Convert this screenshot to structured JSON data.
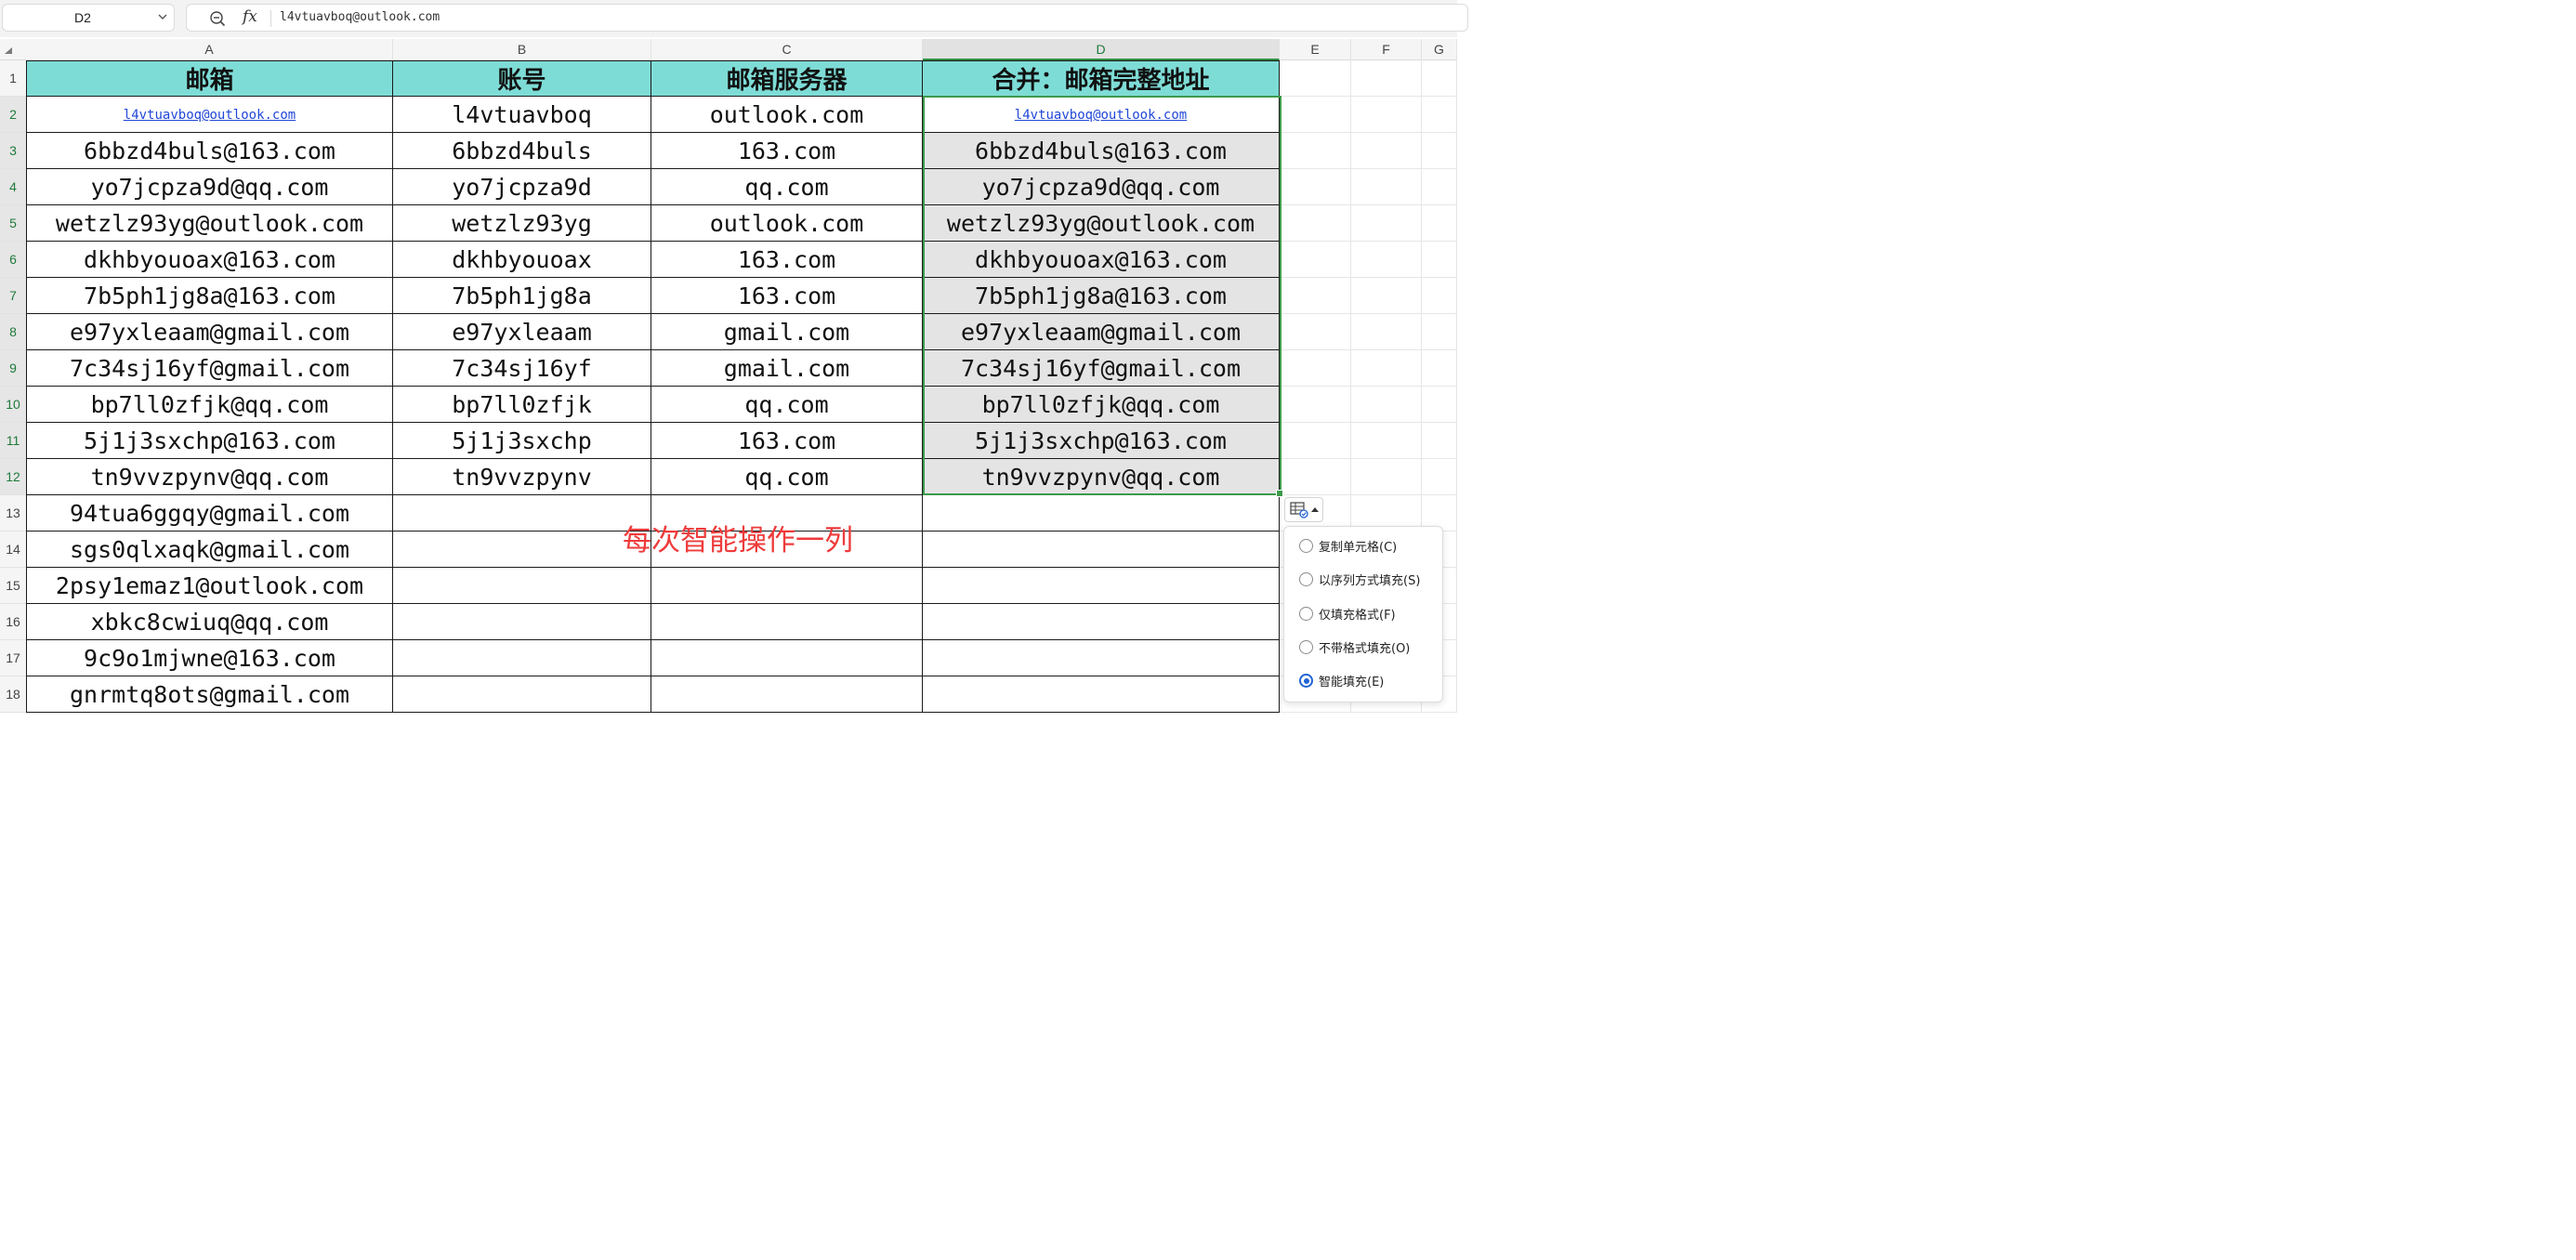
{
  "formula_bar": {
    "name_box": "D2",
    "fx_label": "fx",
    "formula": "l4vtuavboq@outlook.com"
  },
  "columns": [
    "A",
    "B",
    "C",
    "D",
    "E",
    "F",
    "G"
  ],
  "active_column": "D",
  "rows": [
    "1",
    "2",
    "3",
    "4",
    "5",
    "6",
    "7",
    "8",
    "9",
    "10",
    "11",
    "12",
    "13",
    "14",
    "15",
    "16",
    "17",
    "18"
  ],
  "sheet": {
    "headers": [
      "邮箱",
      "账号",
      "邮箱服务器",
      "合并：邮箱完整地址"
    ],
    "data": [
      [
        "l4vtuavboq@outlook.com",
        "l4vtuavboq",
        "outlook.com",
        "l4vtuavboq@outlook.com"
      ],
      [
        "6bbzd4buls@163.com",
        "6bbzd4buls",
        "163.com",
        "6bbzd4buls@163.com"
      ],
      [
        "yo7jcpza9d@qq.com",
        "yo7jcpza9d",
        "qq.com",
        "yo7jcpza9d@qq.com"
      ],
      [
        "wetzlz93yg@outlook.com",
        "wetzlz93yg",
        "outlook.com",
        "wetzlz93yg@outlook.com"
      ],
      [
        "dkhbyouoax@163.com",
        "dkhbyouoax",
        "163.com",
        "dkhbyouoax@163.com"
      ],
      [
        "7b5ph1jg8a@163.com",
        "7b5ph1jg8a",
        "163.com",
        "7b5ph1jg8a@163.com"
      ],
      [
        "e97yxleaam@gmail.com",
        "e97yxleaam",
        "gmail.com",
        "e97yxleaam@gmail.com"
      ],
      [
        "7c34sj16yf@gmail.com",
        "7c34sj16yf",
        "gmail.com",
        "7c34sj16yf@gmail.com"
      ],
      [
        "bp7ll0zfjk@qq.com",
        "bp7ll0zfjk",
        "qq.com",
        "bp7ll0zfjk@qq.com"
      ],
      [
        "5j1j3sxchp@163.com",
        "5j1j3sxchp",
        "163.com",
        "5j1j3sxchp@163.com"
      ],
      [
        "tn9vvzpynv@qq.com",
        "tn9vvzpynv",
        "qq.com",
        "tn9vvzpynv@qq.com"
      ],
      [
        "94tua6ggqy@gmail.com",
        "",
        "",
        ""
      ],
      [
        "sgs0qlxaqk@gmail.com",
        "",
        "",
        ""
      ],
      [
        "2psy1emaz1@outlook.com",
        "",
        "",
        ""
      ],
      [
        "xbkc8cwiuq@qq.com",
        "",
        "",
        ""
      ],
      [
        "9c9o1mjwne@163.com",
        "",
        "",
        ""
      ],
      [
        "gnrmtq8ots@gmail.com",
        "",
        "",
        ""
      ]
    ]
  },
  "annotation": "每次智能操作一列",
  "autofill_options": {
    "items": [
      {
        "label": "复制单元格(C)",
        "selected": false
      },
      {
        "label": "以序列方式填充(S)",
        "selected": false
      },
      {
        "label": "仅填充格式(F)",
        "selected": false
      },
      {
        "label": "不带格式填充(O)",
        "selected": false
      },
      {
        "label": "智能填充(E)",
        "selected": true
      }
    ]
  },
  "colors": {
    "header_fill": "#7edcd6",
    "filled_fill": "#e4e4e4",
    "selection": "#3c9a4a",
    "annotation": "#ee3b3b",
    "link": "#2047d8",
    "radio_on": "#1f63d6"
  }
}
